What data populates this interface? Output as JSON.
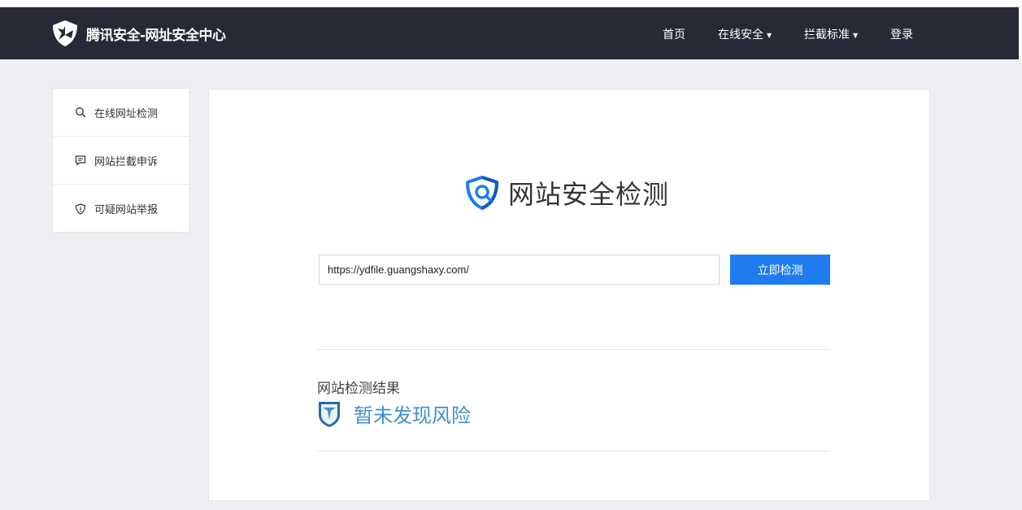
{
  "header": {
    "logo_text": "腾讯安全-网址安全中心",
    "nav": [
      {
        "label": "首页",
        "has_dropdown": false
      },
      {
        "label": "在线安全",
        "has_dropdown": true
      },
      {
        "label": "拦截标准",
        "has_dropdown": true
      },
      {
        "label": "登录",
        "has_dropdown": false
      }
    ],
    "dropdown_glyph": "▼"
  },
  "sidebar": {
    "items": [
      {
        "label": "在线网址检测",
        "icon": "search-icon"
      },
      {
        "label": "网站拦截申诉",
        "icon": "comment-icon"
      },
      {
        "label": "可疑网站举报",
        "icon": "shield-alert-icon"
      }
    ]
  },
  "main": {
    "title": "网站安全检测",
    "url_input_value": "https://ydfile.guangshaxy.com/",
    "check_button": "立即检测",
    "result_title": "网站检测结果",
    "result_status": "暂未发现风险"
  },
  "colors": {
    "navbar_bg": "#272a36",
    "accent_blue": "#1e7cf0",
    "result_blue": "#3f8fce",
    "page_bg": "#efeff3"
  }
}
